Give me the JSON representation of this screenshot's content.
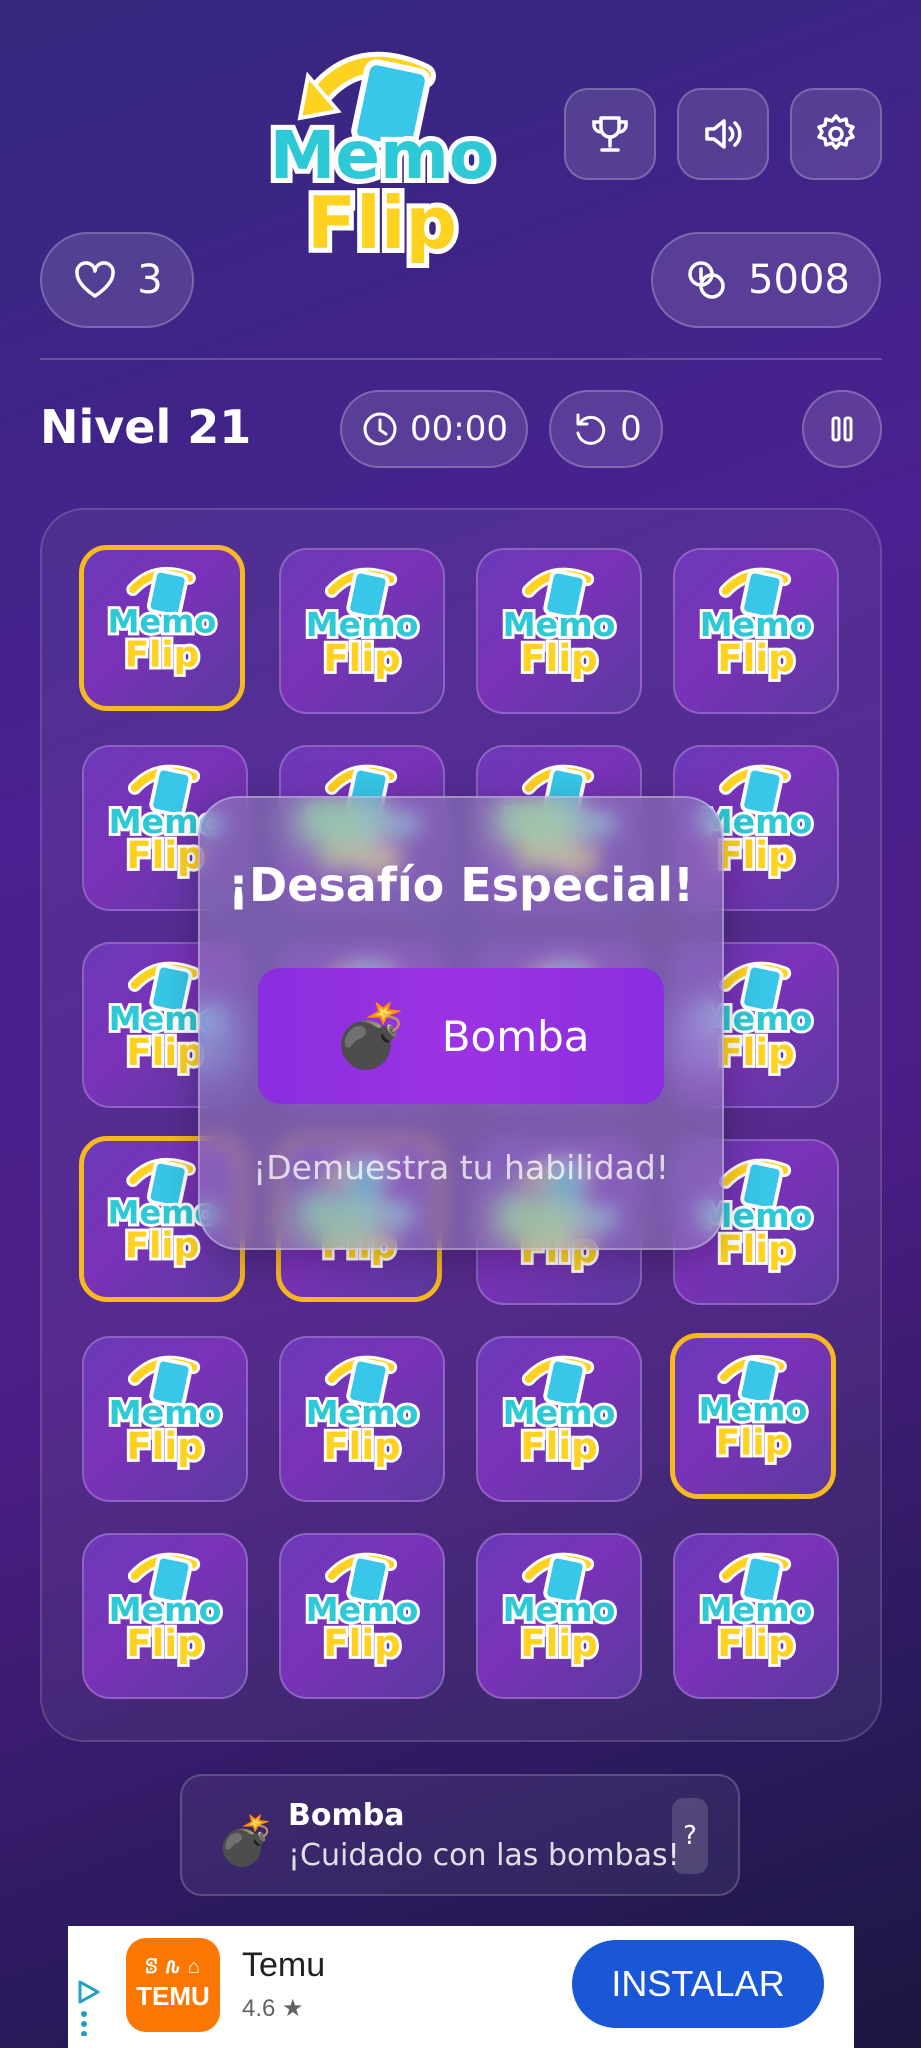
{
  "app": {
    "logo_word_1": "Memo",
    "logo_word_2": "Flip"
  },
  "header": {
    "trophy_icon": "trophy-icon",
    "sound_icon": "speaker-icon",
    "settings_icon": "gear-icon",
    "lives": "3",
    "coins": "5008"
  },
  "level": {
    "title": "Nivel 21",
    "timer": "00:00",
    "moves": "0"
  },
  "board": {
    "rows": 6,
    "cols": 4,
    "highlighted_cards": [
      0,
      12,
      13,
      19
    ]
  },
  "modal": {
    "title": "¡Desafío Especial!",
    "challenge_label": "Bomba",
    "challenge_emoji": "💣",
    "subtitle": "¡Demuestra tu habilidad!"
  },
  "hint": {
    "emoji": "💣",
    "title": "Bomba",
    "description": "¡Cuidado con las bombas!",
    "help": "?"
  },
  "ad": {
    "logo_top": "ꕷ 𐒐 ⌂",
    "logo_text": "TEMU",
    "name": "Temu",
    "rating": "4.6 ★",
    "install": "INSTALAR"
  },
  "colors": {
    "accent_gold": "#f6b91f",
    "logo_teal": "#2ec9d6",
    "logo_yellow": "#ffd21f",
    "challenge_purple": "#8a2ee0",
    "install_blue": "#1a57d6"
  }
}
